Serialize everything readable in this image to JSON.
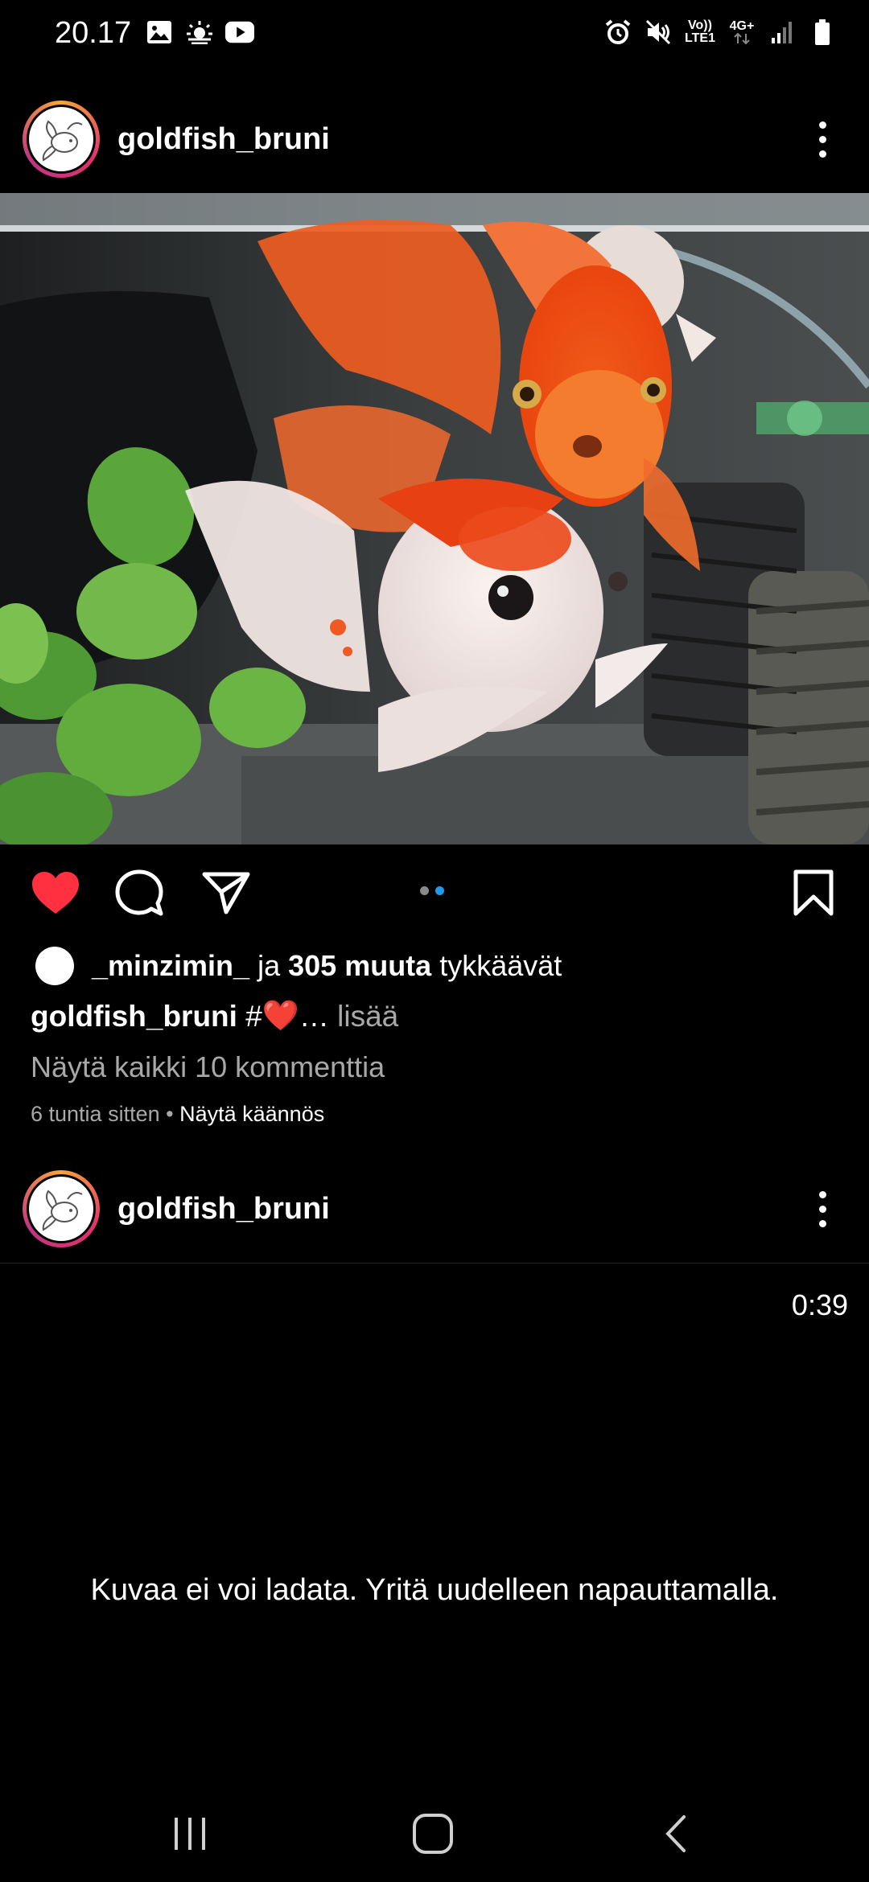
{
  "status_bar": {
    "time": "20.17",
    "left_icons": [
      "gallery-icon",
      "weather-icon",
      "youtube-icon"
    ],
    "right_icons": [
      "alarm-icon",
      "mute-icon",
      "volte-icon",
      "network-4g-icon",
      "signal-icon",
      "battery-icon"
    ],
    "volte_text": "Vo))",
    "lte_text": "LTE1",
    "network_text": "4G+"
  },
  "post1": {
    "username": "goldfish_bruni",
    "likes": {
      "first_liker": "_minzimin_",
      "connector": "ja",
      "count_text": "305 muuta",
      "suffix": "tykkäävät"
    },
    "caption": {
      "username": "goldfish_bruni",
      "hashtag": "#",
      "emoji": "❤️",
      "ellipsis": "…",
      "more": "lisää"
    },
    "view_comments": "Näytä kaikki 10 kommenttia",
    "timestamp": "6 tuntia sitten",
    "separator": "•",
    "translate": "Näytä käännös",
    "carousel_pages": 2,
    "carousel_active": 2
  },
  "post2": {
    "username": "goldfish_bruni",
    "video_time": "0:39",
    "load_error": "Kuvaa ei voi ladata. Yritä uudelleen napauttamalla."
  },
  "colors": {
    "background": "#000000",
    "like_red": "#ff3040",
    "carousel_active": "#1c9bef",
    "muted_text": "#a8a8a8"
  }
}
